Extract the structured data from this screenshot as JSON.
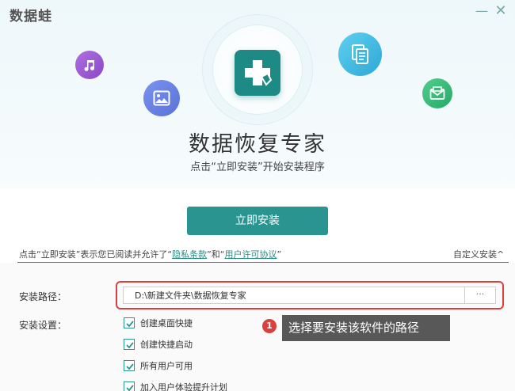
{
  "window": {
    "brand": "数据蛙",
    "minimize_glyph": "—",
    "close_glyph": "✕"
  },
  "hero": {
    "title": "数据恢复专家",
    "subtitle": "点击“立即安装”开始安装程序",
    "icons": [
      "music-icon",
      "image-icon",
      "documents-icon",
      "mail-icon"
    ],
    "colors": {
      "logo": "#1e8a86",
      "music": "#9a57d4",
      "image": "#6580e2",
      "docs": "#3bb7e2",
      "mail": "#35b978"
    }
  },
  "install": {
    "button_label": "立即安装",
    "accent": "#2a9490"
  },
  "agreement": {
    "prefix": "点击“立即安装”表示您已阅读并允许了“",
    "privacy_link": "隐私条款",
    "middle": "”和“",
    "license_link": "用户许可协议",
    "suffix": "”",
    "custom_install": "自定义安装^"
  },
  "settings": {
    "path_label": "安装路径：",
    "path_value": "D:\\新建文件夹\\数据恢复专家",
    "browse_label": "···",
    "settings_label": "安装设置：",
    "options": [
      {
        "label": "创建桌面快捷",
        "checked": true
      },
      {
        "label": "创建快捷启动",
        "checked": true
      },
      {
        "label": "所有用户可用",
        "checked": true
      },
      {
        "label": "加入用户体验提升计划",
        "checked": true
      }
    ]
  },
  "callout": {
    "number": "1",
    "text": "选择要安装该软件的路径",
    "highlight_color": "#d8413d"
  }
}
